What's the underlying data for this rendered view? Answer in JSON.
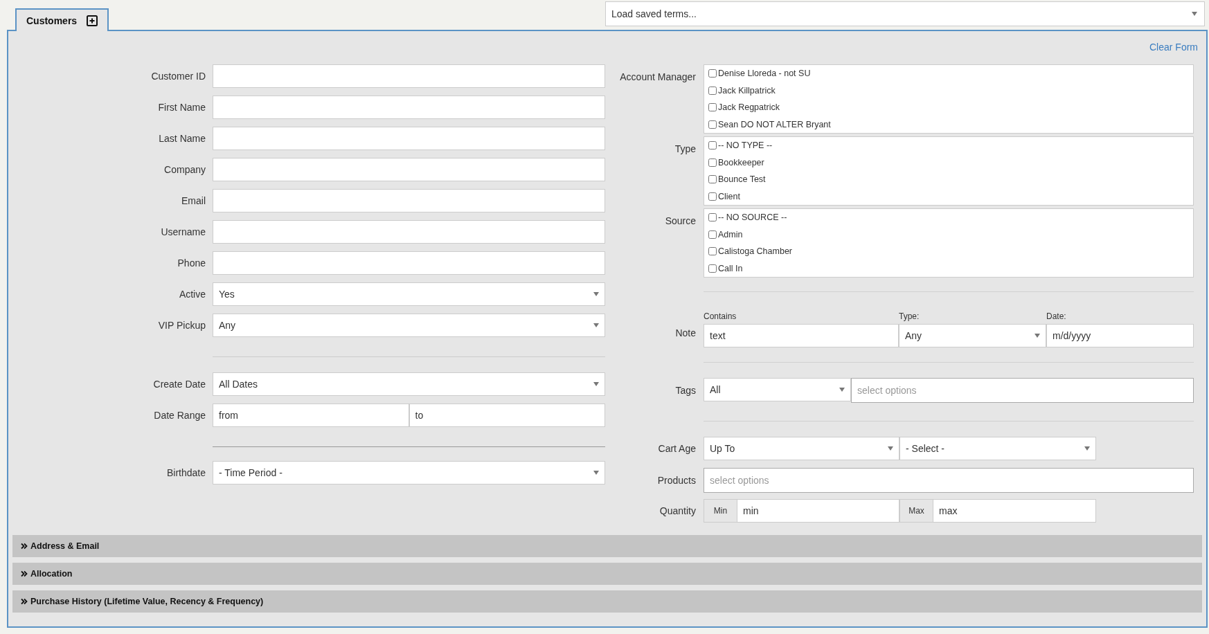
{
  "tabs": [
    {
      "label": "Customers",
      "selected": true
    }
  ],
  "saved_terms": {
    "value": "Load saved terms..."
  },
  "clear_form": "Clear Form",
  "left_groups": [
    [
      {
        "label": "Customer ID",
        "kind": "text"
      },
      {
        "label": "First Name",
        "kind": "text"
      },
      {
        "label": "Last Name",
        "kind": "text"
      },
      {
        "label": "Company",
        "kind": "text"
      },
      {
        "label": "Email",
        "kind": "text"
      },
      {
        "label": "Username",
        "kind": "text"
      },
      {
        "label": "Phone",
        "kind": "text"
      },
      {
        "label": "Active",
        "kind": "select",
        "value": "Yes"
      },
      {
        "label": "VIP Pickup",
        "kind": "select",
        "value": "Any"
      }
    ],
    [
      {
        "label": "Create Date",
        "kind": "select",
        "value": "All Dates"
      },
      {
        "label": "Date Range",
        "kind": "range",
        "from_placeholder": "from",
        "to_placeholder": "to"
      }
    ],
    [
      {
        "label": "Birthdate",
        "kind": "select",
        "value": "- Time Period -"
      }
    ]
  ],
  "checkbox_groups": [
    {
      "label": "Account Manager",
      "options": [
        {
          "label": "Denise Lloreda - not SU",
          "checked": false
        },
        {
          "label": "Jack Killpatrick",
          "checked": false
        },
        {
          "label": "Jack Regpatrick",
          "checked": false
        },
        {
          "label": "Sean DO NOT ALTER Bryant",
          "checked": false
        }
      ]
    },
    {
      "label": "Type",
      "options": [
        {
          "label": "-- NO TYPE --",
          "checked": false
        },
        {
          "label": "Bookkeeper",
          "checked": false
        },
        {
          "label": "Bounce Test",
          "checked": false
        },
        {
          "label": "Client",
          "checked": false
        }
      ]
    },
    {
      "label": "Source",
      "options": [
        {
          "label": "-- NO SOURCE --",
          "checked": false
        },
        {
          "label": "Admin",
          "checked": false
        },
        {
          "label": "Calistoga Chamber",
          "checked": false
        },
        {
          "label": "Call In",
          "checked": false
        }
      ]
    }
  ],
  "note": {
    "label": "Note",
    "contains": {
      "caption": "Contains",
      "placeholder": "text"
    },
    "type": {
      "caption": "Type:",
      "value": "Any"
    },
    "date": {
      "caption": "Date:",
      "placeholder": "m/d/yyyy"
    }
  },
  "tags": {
    "label": "Tags",
    "match": "All",
    "placeholder": "select options"
  },
  "cart_age": {
    "label": "Cart Age",
    "mode": "Up To",
    "period": "- Select -"
  },
  "products": {
    "label": "Products",
    "placeholder": "select options"
  },
  "quantity": {
    "label": "Quantity",
    "min_label": "Min",
    "min_placeholder": "min",
    "max_label": "Max",
    "max_placeholder": "max"
  },
  "sections": [
    {
      "title": "Address & Email"
    },
    {
      "title": "Allocation"
    },
    {
      "title": "Purchase History (Lifetime Value, Recency & Frequency)"
    }
  ]
}
